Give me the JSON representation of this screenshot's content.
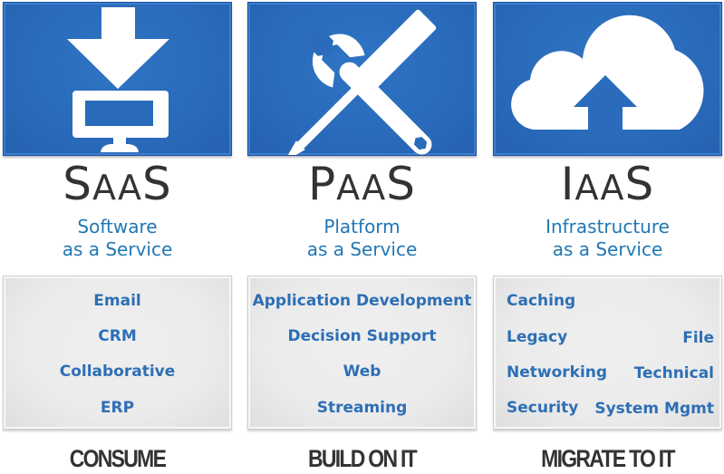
{
  "columns": [
    {
      "icon": "download-to-monitor-icon",
      "abbr": {
        "first": "S",
        "middle": "AA",
        "last": "S"
      },
      "full_line1": "Software",
      "full_line2": "as a Service",
      "items": [
        "Email",
        "CRM",
        "Collaborative",
        "ERP"
      ],
      "verb": "CONSUME"
    },
    {
      "icon": "wrench-screwdriver-icon",
      "abbr": {
        "first": "P",
        "middle": "AA",
        "last": "S"
      },
      "full_line1": "Platform",
      "full_line2": "as a Service",
      "items": [
        "Application Development",
        "Decision Support",
        "Web",
        "Streaming"
      ],
      "verb": "BUILD ON IT"
    },
    {
      "icon": "cloud-upload-icon",
      "abbr": {
        "first": "I",
        "middle": "AA",
        "last": "S"
      },
      "full_line1": "Infrastructure",
      "full_line2": "as a Service",
      "items_left": [
        "Caching",
        "Legacy",
        "Networking",
        "Security"
      ],
      "items_right": [
        "File",
        "Technical",
        "System Mgmt"
      ],
      "verb": "MIGRATE TO IT"
    }
  ],
  "colors": {
    "tile_blue": "#2a6bbb",
    "subtitle_blue": "#1f77b4",
    "item_blue": "#2d6fb5",
    "heading_gray": "#333333"
  }
}
